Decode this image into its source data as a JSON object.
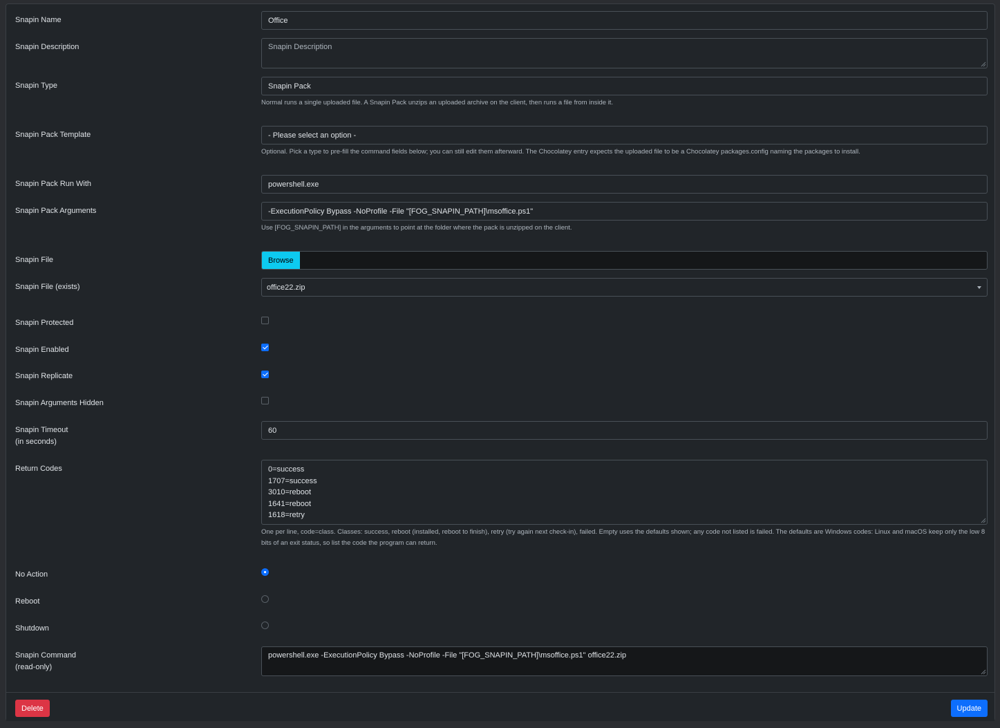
{
  "fields": {
    "name": {
      "label": "Snapin Name",
      "value": "Office"
    },
    "description": {
      "label": "Snapin Description",
      "placeholder": "Snapin Description"
    },
    "type": {
      "label": "Snapin Type",
      "value": "Snapin Pack",
      "help": "Normal runs a single uploaded file. A Snapin Pack unzips an uploaded archive on the client, then runs a file from inside it."
    },
    "pack_template": {
      "label": "Snapin Pack Template",
      "value": "- Please select an option -",
      "help": "Optional. Pick a type to pre-fill the command fields below; you can still edit them afterward. The Chocolatey entry expects the uploaded file to be a Chocolatey packages.config naming the packages to install."
    },
    "run_with": {
      "label": "Snapin Pack Run With",
      "value": "powershell.exe"
    },
    "arguments": {
      "label": "Snapin Pack Arguments",
      "value": "-ExecutionPolicy Bypass -NoProfile -File \"[FOG_SNAPIN_PATH]\\msoffice.ps1\"",
      "help": "Use [FOG_SNAPIN_PATH] in the arguments to point at the folder where the pack is unzipped on the client."
    },
    "file": {
      "label": "Snapin File",
      "button": "Browse"
    },
    "file_exists": {
      "label": "Snapin File (exists)",
      "value": "office22.zip"
    },
    "protected": {
      "label": "Snapin Protected",
      "checked": false
    },
    "enabled": {
      "label": "Snapin Enabled",
      "checked": true
    },
    "replicate": {
      "label": "Snapin Replicate",
      "checked": true
    },
    "args_hidden": {
      "label": "Snapin Arguments Hidden",
      "checked": false
    },
    "timeout": {
      "label": "Snapin Timeout\n(in seconds)",
      "value": "60"
    },
    "return_codes": {
      "label": "Return Codes",
      "lines": [
        "0=success",
        "1707=success",
        "3010=reboot",
        "1641=reboot",
        "1618=retry"
      ],
      "help": "One per line, code=class. Classes: success, reboot (installed, reboot to finish), retry (try again next check-in), failed. Empty uses the defaults shown; any code not listed is failed. The defaults are Windows codes: Linux and macOS keep only the low 8 bits of an exit status, so list the code the program can return."
    },
    "action_none": {
      "label": "No Action",
      "selected": true
    },
    "action_reboot": {
      "label": "Reboot",
      "selected": false
    },
    "action_shutdown": {
      "label": "Shutdown",
      "selected": false
    },
    "command": {
      "label": "Snapin Command\n(read-only)",
      "value": "powershell.exe -ExecutionPolicy Bypass -NoProfile -File \"[FOG_SNAPIN_PATH]\\msoffice.ps1\" office22.zip"
    }
  },
  "footer": {
    "delete_label": "Delete",
    "update_label": "Update"
  },
  "colors": {
    "accent": "#0d6efd",
    "danger": "#dc3545",
    "info": "#0dcaf0"
  }
}
